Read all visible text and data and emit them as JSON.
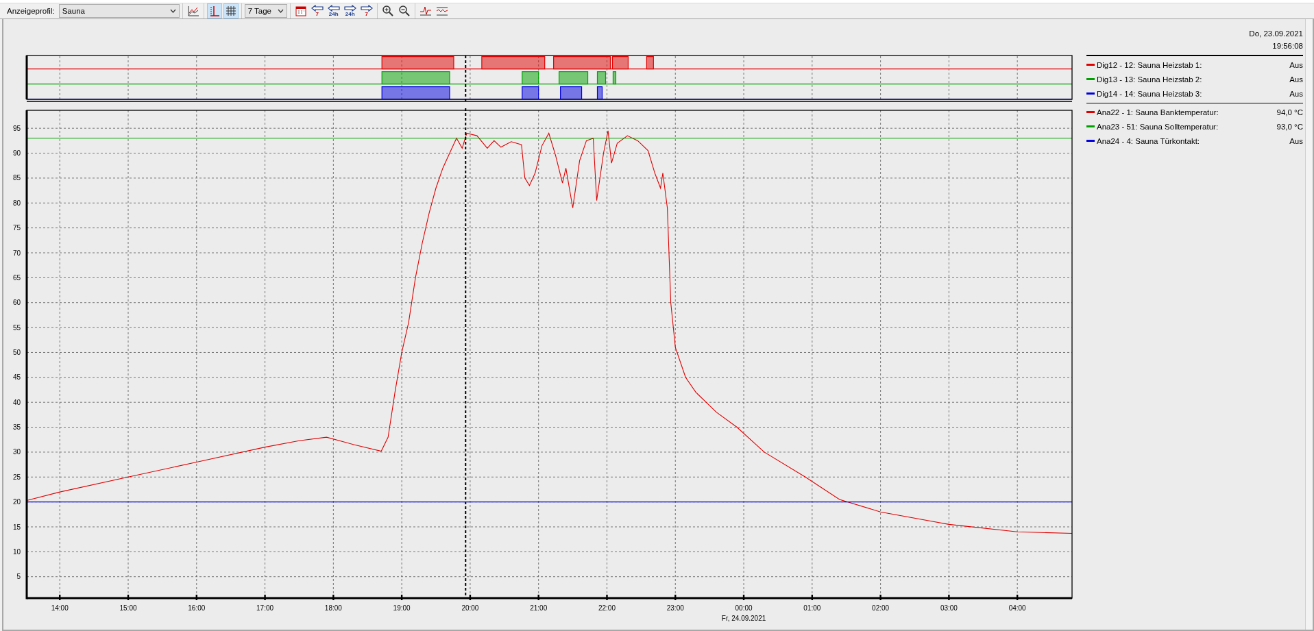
{
  "toolbar": {
    "groups": [
      [
        {
          "kind": "label",
          "text": "Anzeigeprofil:"
        },
        {
          "kind": "dropdown",
          "value": "Sauna",
          "wide": true
        }
      ],
      [
        {
          "kind": "chart",
          "selected": false
        }
      ],
      [
        {
          "kind": "cursor",
          "selected": true
        },
        {
          "kind": "grid",
          "selected": true
        }
      ],
      [
        {
          "kind": "dropdown",
          "value": "7 Tage",
          "wide": false
        }
      ],
      [
        {
          "kind": "calendar"
        },
        {
          "kind": "back",
          "label": "7"
        },
        {
          "kind": "back",
          "label": "24h"
        },
        {
          "kind": "forward",
          "label": "24h"
        },
        {
          "kind": "forward",
          "label": "7"
        }
      ],
      [
        {
          "kind": "zoom_in"
        },
        {
          "kind": "zoom_out"
        }
      ],
      [
        {
          "kind": "trend"
        },
        {
          "kind": "trend_flat"
        }
      ]
    ]
  },
  "main_chart": {
    "chart_data": {
      "type": "line",
      "grid": true,
      "xlim": [
        "2021-09-23 13:31",
        "2021-09-24 04:48"
      ],
      "ylim": [
        0.7,
        98.6
      ],
      "yticks": [
        5,
        10,
        15,
        20,
        25,
        30,
        35,
        40,
        45,
        50,
        55,
        60,
        65,
        70,
        75,
        80,
        85,
        90,
        95
      ],
      "xticks": [
        {
          "value": "2021-09-23 14:00",
          "label": "14:00"
        },
        {
          "value": "2021-09-23 15:00",
          "label": "15:00"
        },
        {
          "value": "2021-09-23 16:00",
          "label": "16:00"
        },
        {
          "value": "2021-09-23 17:00",
          "label": "17:00"
        },
        {
          "value": "2021-09-23 18:00",
          "label": "18:00"
        },
        {
          "value": "2021-09-23 19:00",
          "label": "19:00"
        },
        {
          "value": "2021-09-23 20:00",
          "label": "20:00"
        },
        {
          "value": "2021-09-23 21:00",
          "label": "21:00"
        },
        {
          "value": "2021-09-23 22:00",
          "label": "22:00"
        },
        {
          "value": "2021-09-23 23:00",
          "label": "23:00"
        },
        {
          "value": "2021-09-24 00:00",
          "label": "00:00"
        },
        {
          "value": "2021-09-24 01:00",
          "label": "01:00"
        },
        {
          "value": "2021-09-24 02:00",
          "label": "02:00"
        },
        {
          "value": "2021-09-24 03:00",
          "label": "03:00"
        },
        {
          "value": "2021-09-24 04:00",
          "label": "04:00"
        }
      ],
      "x": [
        "2021-09-23 13:31",
        "2021-09-23 14:00",
        "2021-09-23 15:00",
        "2021-09-23 16:00",
        "2021-09-23 17:00",
        "2021-09-23 17:30",
        "2021-09-23 17:54",
        "2021-09-23 18:18",
        "2021-09-23 18:42",
        "2021-09-23 18:48",
        "2021-09-23 18:54",
        "2021-09-23 19:00",
        "2021-09-23 19:06",
        "2021-09-23 19:12",
        "2021-09-23 19:18",
        "2021-09-23 19:24",
        "2021-09-23 19:30",
        "2021-09-23 19:36",
        "2021-09-23 19:42",
        "2021-09-23 19:48",
        "2021-09-23 19:53",
        "2021-09-23 19:57",
        "2021-09-23 20:06",
        "2021-09-23 20:15",
        "2021-09-23 20:21",
        "2021-09-23 20:27",
        "2021-09-23 20:36",
        "2021-09-23 20:45",
        "2021-09-23 20:48",
        "2021-09-23 20:52",
        "2021-09-23 20:57",
        "2021-09-23 21:03",
        "2021-09-23 21:09",
        "2021-09-23 21:15",
        "2021-09-23 21:21",
        "2021-09-23 21:24",
        "2021-09-23 21:30",
        "2021-09-23 21:36",
        "2021-09-23 21:42",
        "2021-09-23 21:48",
        "2021-09-23 21:51",
        "2021-09-23 21:57",
        "2021-09-23 22:01",
        "2021-09-23 22:04",
        "2021-09-23 22:09",
        "2021-09-23 22:18",
        "2021-09-23 22:27",
        "2021-09-23 22:36",
        "2021-09-23 22:42",
        "2021-09-23 22:47",
        "2021-09-23 22:49",
        "2021-09-23 22:53",
        "2021-09-23 22:56",
        "2021-09-23 23:00",
        "2021-09-23 23:09",
        "2021-09-23 23:18",
        "2021-09-23 23:36",
        "2021-09-23 23:54",
        "2021-09-24 00:18",
        "2021-09-24 00:54",
        "2021-09-24 01:24",
        "2021-09-24 02:00",
        "2021-09-24 03:00",
        "2021-09-24 04:00",
        "2021-09-24 04:48"
      ],
      "series": [
        {
          "name": "Ana22 - 1: Sauna Banktemperatur:",
          "color": "#e00000",
          "values": [
            20.3,
            22,
            25,
            28,
            31,
            32.3,
            33,
            31.5,
            30.2,
            33,
            42,
            50,
            56,
            65,
            72,
            78,
            83,
            87,
            90,
            93,
            91,
            94,
            93.5,
            91,
            92.5,
            91.2,
            92.3,
            91.7,
            85,
            83.5,
            86,
            91.5,
            94,
            89.5,
            84,
            87,
            79,
            88.5,
            92.5,
            93,
            80.5,
            90,
            94.5,
            88,
            92,
            93.5,
            92.5,
            90.5,
            86,
            83,
            86,
            79,
            60,
            51,
            45,
            42,
            38,
            35,
            30,
            25,
            20.5,
            18,
            15.5,
            14,
            13.7
          ]
        },
        {
          "name": "Ana23 - 51: Sauna Solltemperatur:",
          "color": "#00a000",
          "values": [
            93,
            93,
            93,
            93,
            93,
            93,
            93,
            93,
            93,
            93,
            93,
            93,
            93,
            93,
            93,
            93,
            93,
            93,
            93,
            93,
            93,
            93,
            93,
            93,
            93,
            93,
            93,
            93,
            93,
            93,
            93,
            93,
            93,
            93,
            93,
            93,
            93,
            93,
            93,
            93,
            93,
            93,
            93,
            93,
            93,
            93,
            93,
            93,
            93,
            93,
            93,
            93,
            93,
            93,
            93,
            93,
            93,
            93,
            93,
            93,
            93,
            93,
            93,
            93,
            93
          ]
        },
        {
          "name": "Ana24 - 4: Sauna Türkontakt:",
          "color": "#0000e0",
          "values": [
            20,
            20,
            20,
            20,
            20,
            20,
            20,
            20,
            20,
            20,
            20,
            20,
            20,
            20,
            20,
            20,
            20,
            20,
            20,
            20,
            20,
            20,
            20,
            20,
            20,
            20,
            20,
            20,
            20,
            20,
            20,
            20,
            20,
            20,
            20,
            20,
            20,
            20,
            20,
            20,
            20,
            20,
            20,
            20,
            20,
            20,
            20,
            20,
            20,
            20,
            20,
            20,
            20,
            20,
            20,
            20,
            20,
            20,
            20,
            20,
            20,
            20,
            20,
            20,
            20
          ]
        }
      ],
      "ref_lines": [
        {
          "axis": "x",
          "value": "2021-09-23 19:56"
        }
      ],
      "annotations": [
        "Fr, 24.09.2021"
      ]
    }
  },
  "legend": {
    "date": "Do, 23.09.2021",
    "time": "19:56:08",
    "digital": [
      {
        "name": "Dig12 - 12: Sauna Heizstab 1:",
        "value": "Aus",
        "color": "#e00000"
      },
      {
        "name": "Dig13 - 13: Sauna Heizstab 2:",
        "value": "Aus",
        "color": "#00a000"
      },
      {
        "name": "Dig14 - 14: Sauna Heizstab 3:",
        "value": "Aus",
        "color": "#0000e0"
      }
    ],
    "analog_values": [
      "94,0 °C",
      "93,0 °C",
      "Aus"
    ]
  }
}
